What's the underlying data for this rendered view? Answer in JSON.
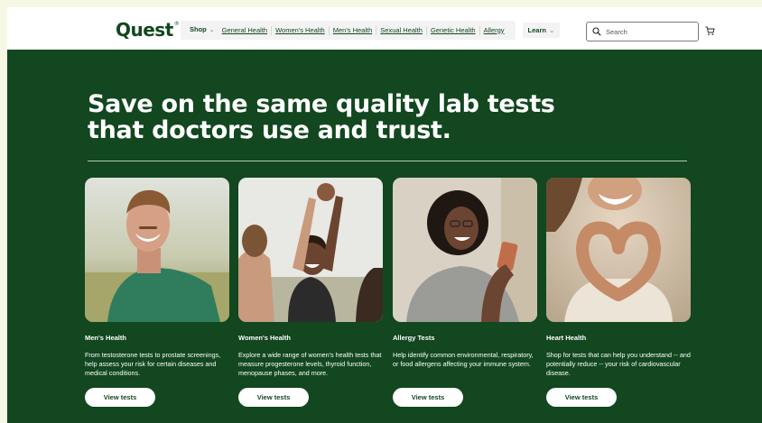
{
  "header": {
    "logo": "Quest",
    "logo_mark": "®",
    "nav": {
      "shop_label": "Shop",
      "links": [
        "General Health",
        "Women's Health",
        "Men's Health",
        "Sexual Health",
        "Genetic Health",
        "Allergy"
      ],
      "learn_label": "Learn"
    },
    "search": {
      "placeholder": "Search",
      "value": ""
    },
    "cart_icon": "cart-icon"
  },
  "hero": {
    "headline_line1": "Save on the same quality lab tests",
    "headline_line2": "that doctors use and trust.",
    "cards": [
      {
        "title": "Men's Health",
        "description": "From testosterone tests to prostate screenings, help assess your risk for certain diseases and medical conditions.",
        "button_label": "View tests"
      },
      {
        "title": "Women's Health",
        "description": "Explore a wide range of women's health tests that measure progesterone levels, thyroid function, menopause phases, and more.",
        "button_label": "View tests"
      },
      {
        "title": "Allergy Tests",
        "description": "Help identify common environmental, respiratory, or food allergens affecting your immune system.",
        "button_label": "View tests"
      },
      {
        "title": "Heart Health",
        "description": "Shop for tests that can help you understand -- and potentially reduce -- your risk of cardiovascular disease.",
        "button_label": "View tests"
      }
    ]
  },
  "colors": {
    "brand_green": "#12471f",
    "page_background": "#f7f7e6",
    "white": "#ffffff"
  }
}
